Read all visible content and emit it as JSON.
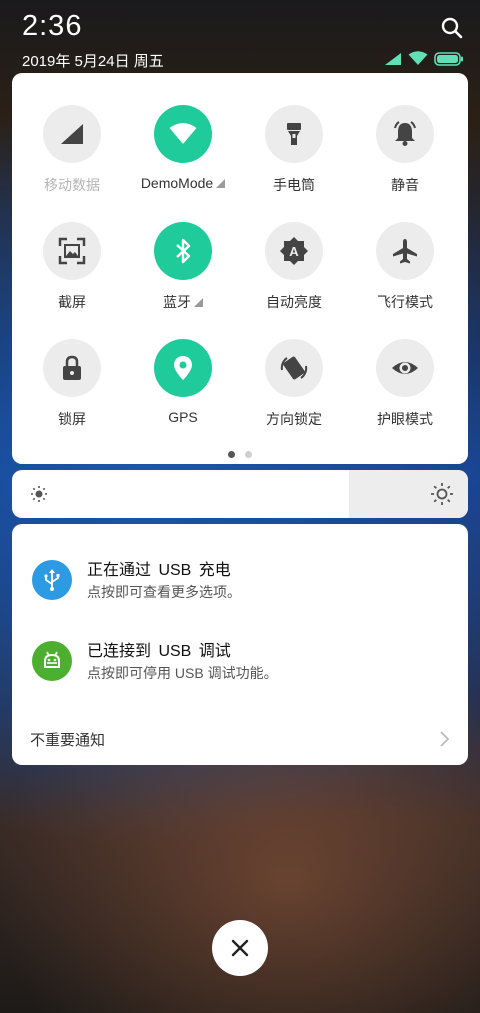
{
  "status_bar": {
    "time": "2:36",
    "date": "2019年 5月24日 周五",
    "icons": [
      "signal-icon",
      "wifi-icon",
      "battery-icon"
    ]
  },
  "quick_settings": {
    "tiles": [
      {
        "label": "移动数据",
        "icon": "mobile-data-icon",
        "active": false,
        "disabled": true,
        "expandable": false
      },
      {
        "label": "DemoMode",
        "icon": "wifi-icon",
        "active": true,
        "disabled": false,
        "expandable": true
      },
      {
        "label": "手电筒",
        "icon": "flashlight-icon",
        "active": false,
        "disabled": false,
        "expandable": false
      },
      {
        "label": "静音",
        "icon": "bell-icon",
        "active": false,
        "disabled": false,
        "expandable": false
      },
      {
        "label": "截屏",
        "icon": "screenshot-icon",
        "active": false,
        "disabled": false,
        "expandable": false
      },
      {
        "label": "蓝牙",
        "icon": "bluetooth-icon",
        "active": true,
        "disabled": false,
        "expandable": true
      },
      {
        "label": "自动亮度",
        "icon": "auto-brightness-icon",
        "active": false,
        "disabled": false,
        "expandable": false
      },
      {
        "label": "飞行模式",
        "icon": "airplane-icon",
        "active": false,
        "disabled": false,
        "expandable": false
      },
      {
        "label": "锁屏",
        "icon": "lock-icon",
        "active": false,
        "disabled": false,
        "expandable": false
      },
      {
        "label": "GPS",
        "icon": "location-pin-icon",
        "active": true,
        "disabled": false,
        "expandable": false
      },
      {
        "label": "方向锁定",
        "icon": "rotation-lock-icon",
        "active": false,
        "disabled": false,
        "expandable": false
      },
      {
        "label": "护眼模式",
        "icon": "eye-icon",
        "active": false,
        "disabled": false,
        "expandable": false
      }
    ],
    "page_count": 2,
    "current_page": 1,
    "active_color": "#1fcb9b"
  },
  "brightness": {
    "level": 0.74
  },
  "notifications": [
    {
      "title": "正在通过 USB 充电",
      "body": "点按即可查看更多选项。",
      "icon": "usb-icon",
      "color": "#2d9be3"
    },
    {
      "title": "已连接到 USB 调试",
      "body": "点按即可停用 USB 调试功能。",
      "icon": "android-icon",
      "color": "#4caf2f"
    }
  ],
  "less_important_label": "不重要通知",
  "close_button_icon": "close-icon"
}
